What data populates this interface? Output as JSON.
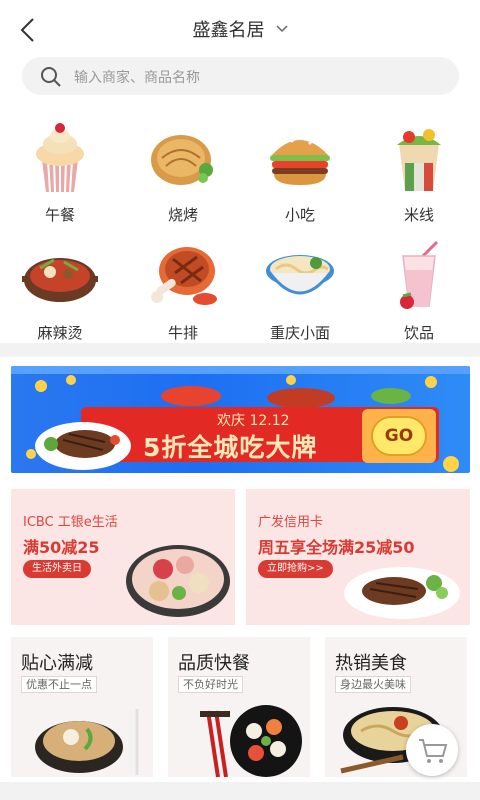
{
  "header": {
    "title": "盛鑫名居",
    "back_icon": "back-arrow-icon",
    "dropdown_icon": "chevron-down-icon"
  },
  "search": {
    "placeholder": "输入商家、商品名称",
    "icon": "search-icon"
  },
  "categories": [
    {
      "label": "午餐",
      "icon": "cupcake-icon"
    },
    {
      "label": "烧烤",
      "icon": "flatbread-icon"
    },
    {
      "label": "小吃",
      "icon": "burger-icon"
    },
    {
      "label": "米线",
      "icon": "wrap-icon"
    },
    {
      "label": "麻辣烫",
      "icon": "hotpot-icon"
    },
    {
      "label": "牛排",
      "icon": "steak-icon"
    },
    {
      "label": "重庆小面",
      "icon": "noodle-bowl-icon"
    },
    {
      "label": "饮品",
      "icon": "drink-icon"
    }
  ],
  "banner": {
    "small": "欢庆 12.12",
    "big": "5折全城吃大牌",
    "go": "GO"
  },
  "promos": [
    {
      "title": "ICBC 工银e生活",
      "headline": "满50减25",
      "pill": "生活外卖日"
    },
    {
      "title": "广发信用卡",
      "headline": "周五享全场满25减50",
      "pill": "立即抢购>>"
    }
  ],
  "features": [
    {
      "title": "贴心满减",
      "sub": "优惠不止一点"
    },
    {
      "title": "品质快餐",
      "sub": "不负好时光"
    },
    {
      "title": "热销美食",
      "sub": "身边最火美味"
    }
  ],
  "cart": {
    "icon": "cart-icon"
  },
  "colors": {
    "accent": "#e32924",
    "banner_blue": "#1d6ff2",
    "promo_bg": "#fbe6e5"
  }
}
